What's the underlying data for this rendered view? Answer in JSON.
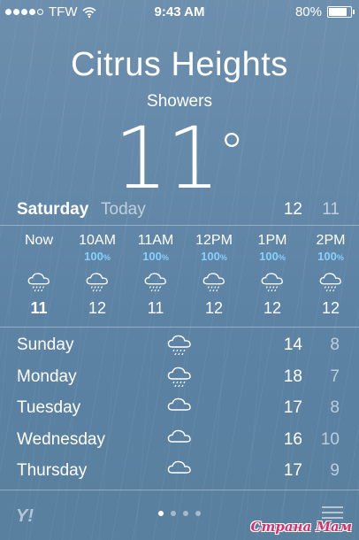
{
  "status_bar": {
    "carrier": "TFW",
    "time": "9:43 AM",
    "battery": "80%",
    "battery_level": 0.8,
    "signal_dots_filled": 4,
    "icons": [
      "signal-icon",
      "wifi-icon",
      "battery-icon"
    ]
  },
  "location": {
    "city": "Citrus Heights",
    "condition": "Showers",
    "temperature": "11",
    "degree": "°"
  },
  "today": {
    "day": "Saturday",
    "label": "Today",
    "high": "12",
    "low": "11"
  },
  "hourly": [
    {
      "time": "Now",
      "precip": "",
      "icon": "rain-cloud-icon",
      "temp": "11",
      "bold": true
    },
    {
      "time": "10AM",
      "precip": "100",
      "icon": "rain-cloud-icon",
      "temp": "12",
      "bold": false
    },
    {
      "time": "11AM",
      "precip": "100",
      "icon": "rain-cloud-icon",
      "temp": "11",
      "bold": false
    },
    {
      "time": "12PM",
      "precip": "100",
      "icon": "rain-cloud-icon",
      "temp": "12",
      "bold": false
    },
    {
      "time": "1PM",
      "precip": "100",
      "icon": "rain-cloud-icon",
      "temp": "12",
      "bold": false
    },
    {
      "time": "2PM",
      "precip": "100",
      "icon": "rain-cloud-icon",
      "temp": "12",
      "bold": false
    }
  ],
  "percent_sign": "%",
  "daily": [
    {
      "day": "Sunday",
      "icon": "rain-cloud-icon",
      "high": "14",
      "low": "8"
    },
    {
      "day": "Monday",
      "icon": "rain-cloud-icon",
      "high": "18",
      "low": "7"
    },
    {
      "day": "Tuesday",
      "icon": "cloud-icon",
      "high": "17",
      "low": "8"
    },
    {
      "day": "Wednesday",
      "icon": "cloud-icon",
      "high": "16",
      "low": "10"
    },
    {
      "day": "Thursday",
      "icon": "cloud-icon",
      "high": "17",
      "low": "9"
    }
  ],
  "bottom": {
    "logo": "Y!",
    "page_count": 4,
    "active_page": 0,
    "watermark": "Страна Мам"
  },
  "colors": {
    "precip": "#86d0ff",
    "watermark": "#d2316b"
  }
}
